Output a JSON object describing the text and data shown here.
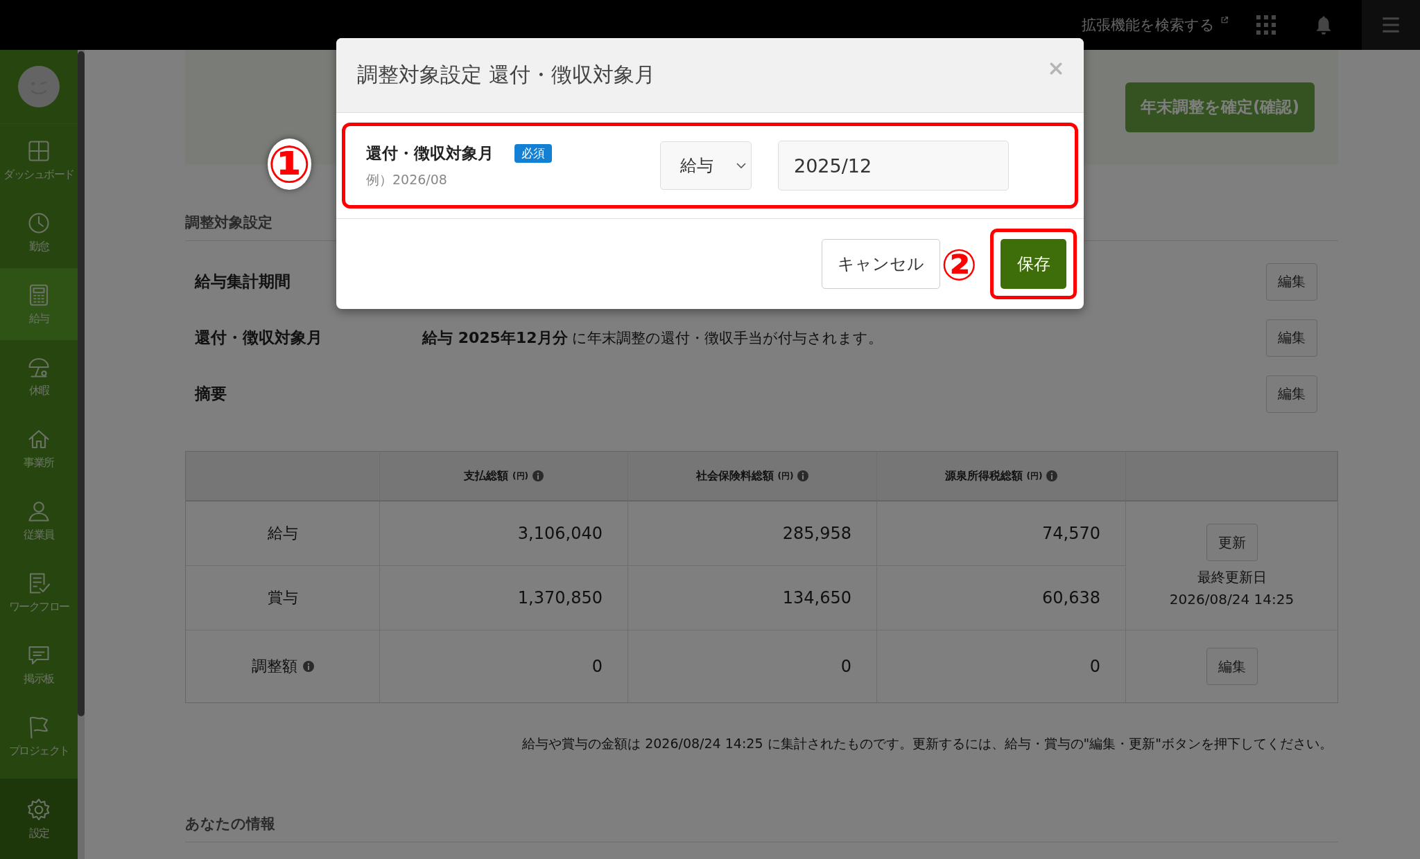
{
  "topbar": {
    "extension_link": "拡張機能を検索する"
  },
  "sidebar": {
    "items": [
      {
        "label": "ダッシュボード",
        "selected": false
      },
      {
        "label": "勤怠",
        "selected": false
      },
      {
        "label": "給与",
        "selected": true
      },
      {
        "label": "休暇",
        "selected": false
      },
      {
        "label": "事業所",
        "selected": false
      },
      {
        "label": "従業員",
        "selected": false
      },
      {
        "label": "ワークフロー",
        "selected": false
      },
      {
        "label": "掲示板",
        "selected": false
      },
      {
        "label": "プロジェクト",
        "selected": false
      }
    ],
    "settings": {
      "label": "設定"
    }
  },
  "page": {
    "confirm_button": "年末調整を確定(確認)",
    "section_title": "調整対象設定",
    "settings_rows": [
      {
        "label": "給与集計期間",
        "button": "編集"
      },
      {
        "label": "還付・徴収対象月",
        "value": "**給与 2025年12月分** に年末調整の還付・徴収手当が付与されます。",
        "button": "編集"
      },
      {
        "label": "摘要",
        "button": "編集"
      }
    ],
    "table": {
      "columns": [
        {
          "label": "支払総額",
          "unit": "(円)"
        },
        {
          "label": "社会保険料総額",
          "unit": "(円)"
        },
        {
          "label": "源泉所得税総額",
          "unit": "(円)"
        }
      ],
      "rows": [
        {
          "label": "給与",
          "info": false,
          "values": [
            "3,106,040",
            "285,958",
            "74,570"
          ]
        },
        {
          "label": "賞与",
          "info": false,
          "values": [
            "1,370,850",
            "134,650",
            "60,638"
          ]
        },
        {
          "label": "調整額",
          "info": true,
          "values": [
            "0",
            "0",
            "0"
          ]
        }
      ],
      "update_panel": {
        "button": "更新",
        "caption": "最終更新日",
        "date": "2026/08/24 14:25"
      },
      "adjust_button": "編集"
    },
    "note": "給与や賞与の金額は 2026/08/24 14:25 に集計されたものです。更新するには、給与・賞与の\"編集・更新\"ボタンを押下してください。",
    "section2_title": "あなたの情報"
  },
  "modal": {
    "title": "調整対象設定 還付・徴収対象月",
    "field_label": "還付・徴収対象月",
    "required_badge": "必須",
    "example": "例）2026/08",
    "select_value": "給与",
    "input_value": "2025/12",
    "cancel_button": "キャンセル",
    "save_button": "保存"
  },
  "annotations": [
    "①",
    "②"
  ]
}
